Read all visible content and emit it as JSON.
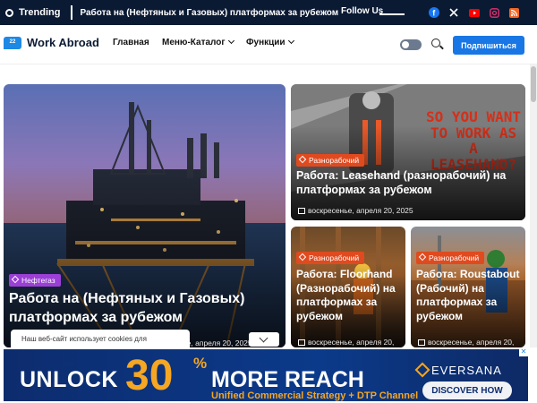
{
  "topbar": {
    "trending_label": "Trending",
    "trending_item": "Работа на (Нефтяных и Газовых) платформах за рубежом",
    "follow_label": "Follow Us",
    "socials": [
      {
        "name": "facebook-icon",
        "glyph": "f",
        "color": "#1877f2"
      },
      {
        "name": "x-icon",
        "glyph": "𝕏",
        "color": "#ffffff"
      },
      {
        "name": "youtube-icon",
        "glyph": "▶",
        "color": "#ff0000"
      },
      {
        "name": "instagram-icon",
        "glyph": "◎",
        "color": "#e1306c"
      },
      {
        "name": "rss-icon",
        "glyph": ")",
        "color": "#f26522"
      }
    ]
  },
  "header": {
    "logo_badge": "22",
    "logo_text": "Work Abroad",
    "nav": [
      "Главная",
      "Меню-Каталог",
      "Функции"
    ],
    "subscribe_label": "Подпишиться"
  },
  "cards": {
    "main": {
      "badge": "Нефтегаз",
      "title": "Работа на (Нефтяных и Газовых) платформах за рубежом",
      "date": "воскресенье, апреля 20, 2025"
    },
    "top_right": {
      "badge": "Разнорабочий",
      "title": "Работа: Leasehand (разнорабочий) на платформах за рубежом",
      "date": "воскресенье, апреля 20, 2025",
      "image_text": "SO YOU WANT TO WORK AS A LEASEHAND?"
    },
    "bottom_left": {
      "badge": "Разнорабочий",
      "title": "Работа: Floorhand (Разнорабочий) на платформах за рубежом",
      "date": "воскресенье, апреля 20,"
    },
    "bottom_right": {
      "badge": "Разнорабочий",
      "title": "Работа: Roustabout (Рабочий) на платформах за рубежом",
      "date": "воскресенье, апреля 20,"
    }
  },
  "cookie": {
    "text": "Наш веб-сайт использует cookies для"
  },
  "ad": {
    "unlock": "UNLOCK",
    "pct": "30",
    "pct_symbol": "%",
    "more": "MORE REACH",
    "sub": "Unified Commercial Strategy + DTP Channel",
    "brand": "EVERSANA",
    "button": "DISCOVER HOW",
    "close": "✕"
  },
  "colors": {
    "topbar_bg": "#0b1a33",
    "accent": "#1877e5",
    "badge": "#e04a1f",
    "ad_orange": "#f5a623"
  }
}
